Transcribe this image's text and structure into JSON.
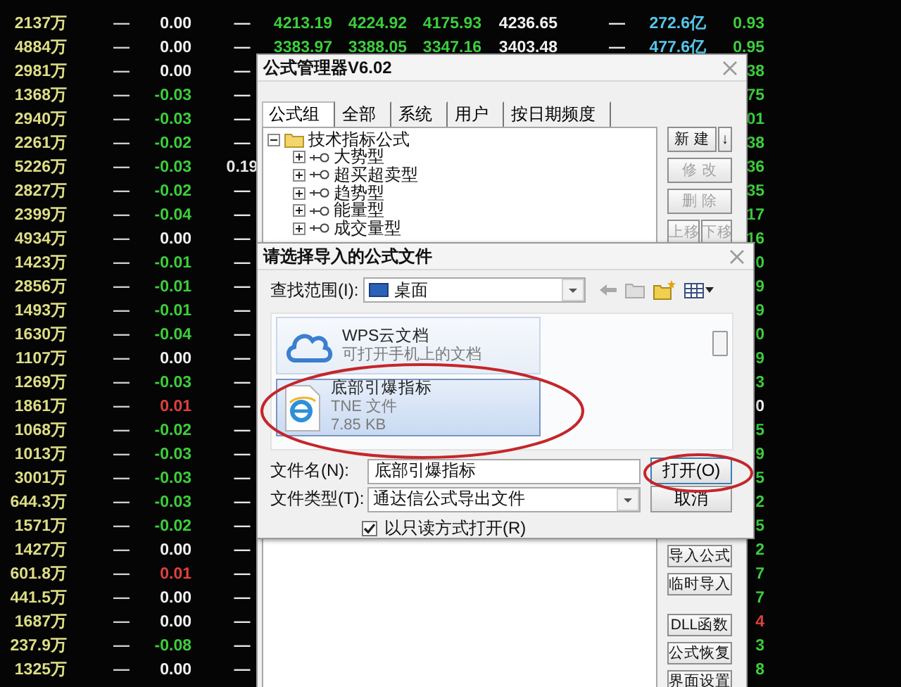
{
  "quote_table": {
    "rows": [
      {
        "amount": "2137万",
        "col_2": "—",
        "change": {
          "text": "0.00",
          "color": "#f2f2f2"
        },
        "col_4": "—",
        "prices": [
          "4213.19",
          "4224.92",
          "4175.93",
          "4236.65"
        ],
        "col_9": "—",
        "volume": "272.6亿",
        "ratio": {
          "text": "0.93",
          "color": "#3ccf3c"
        }
      },
      {
        "amount": "4884万",
        "col_2": "—",
        "change": {
          "text": "0.00",
          "color": "#f2f2f2"
        },
        "col_4": "—",
        "prices": [
          "3383.97",
          "3388.05",
          "3347.16",
          "3403.48"
        ],
        "col_9": "—",
        "volume": "477.6亿",
        "ratio": {
          "text": "0.95",
          "color": "#3ccf3c"
        }
      },
      {
        "amount": "2981万",
        "col_2": "—",
        "change": {
          "text": "0.00",
          "color": "#f2f2f2"
        },
        "col_4": "—",
        "ratio": {
          "text": "38",
          "color": "#3ccf3c"
        }
      },
      {
        "amount": "1368万",
        "col_2": "—",
        "change": {
          "text": "-0.03",
          "color": "#3ccf3c"
        },
        "col_4": "—",
        "ratio": {
          "text": "75",
          "color": "#3ccf3c"
        }
      },
      {
        "amount": "2940万",
        "col_2": "—",
        "change": {
          "text": "-0.03",
          "color": "#3ccf3c"
        },
        "col_4": "—",
        "ratio": {
          "text": "01",
          "color": "#3ccf3c"
        }
      },
      {
        "amount": "2261万",
        "col_2": "—",
        "change": {
          "text": "-0.02",
          "color": "#3ccf3c"
        },
        "col_4": "—",
        "ratio": {
          "text": "38",
          "color": "#3ccf3c"
        }
      },
      {
        "amount": "5226万",
        "col_2": "—",
        "change": {
          "text": "-0.03",
          "color": "#3ccf3c"
        },
        "col_4": "0.19",
        "ratio": {
          "text": "36",
          "color": "#3ccf3c"
        }
      },
      {
        "amount": "2827万",
        "col_2": "—",
        "change": {
          "text": "-0.02",
          "color": "#3ccf3c"
        },
        "col_4": "—",
        "ratio": {
          "text": "35",
          "color": "#3ccf3c"
        }
      },
      {
        "amount": "2399万",
        "col_2": "—",
        "change": {
          "text": "-0.04",
          "color": "#3ccf3c"
        },
        "col_4": "—",
        "ratio": {
          "text": "17",
          "color": "#3ccf3c"
        }
      },
      {
        "amount": "4934万",
        "col_2": "—",
        "change": {
          "text": "0.00",
          "color": "#f2f2f2"
        },
        "col_4": "—",
        "ratio": {
          "text": "16",
          "color": "#3ccf3c"
        }
      },
      {
        "amount": "1423万",
        "col_2": "—",
        "change": {
          "text": "-0.01",
          "color": "#3ccf3c"
        },
        "col_4": "—",
        "ratio": {
          "text": "0",
          "color": "#3ccf3c"
        }
      },
      {
        "amount": "2856万",
        "col_2": "—",
        "change": {
          "text": "-0.01",
          "color": "#3ccf3c"
        },
        "col_4": "—",
        "ratio": {
          "text": "9",
          "color": "#3ccf3c"
        }
      },
      {
        "amount": "1493万",
        "col_2": "—",
        "change": {
          "text": "-0.01",
          "color": "#3ccf3c"
        },
        "col_4": "—",
        "ratio": {
          "text": "9",
          "color": "#3ccf3c"
        }
      },
      {
        "amount": "1630万",
        "col_2": "—",
        "change": {
          "text": "-0.04",
          "color": "#3ccf3c"
        },
        "col_4": "—",
        "ratio": {
          "text": "0",
          "color": "#3ccf3c"
        }
      },
      {
        "amount": "1107万",
        "col_2": "—",
        "change": {
          "text": "0.00",
          "color": "#f2f2f2"
        },
        "col_4": "—",
        "ratio": {
          "text": "9",
          "color": "#3ccf3c"
        }
      },
      {
        "amount": "1269万",
        "col_2": "—",
        "change": {
          "text": "-0.03",
          "color": "#3ccf3c"
        },
        "col_4": "—",
        "ratio": {
          "text": "3",
          "color": "#3ccf3c"
        }
      },
      {
        "amount": "1861万",
        "col_2": "—",
        "change": {
          "text": "0.01",
          "color": "#e04040"
        },
        "col_4": "—",
        "ratio": {
          "text": "0",
          "color": "#f2f2f2"
        }
      },
      {
        "amount": "1068万",
        "col_2": "—",
        "change": {
          "text": "-0.02",
          "color": "#3ccf3c"
        },
        "col_4": "—",
        "ratio": {
          "text": "5",
          "color": "#3ccf3c"
        }
      },
      {
        "amount": "1013万",
        "col_2": "—",
        "change": {
          "text": "-0.03",
          "color": "#3ccf3c"
        },
        "col_4": "—",
        "ratio": {
          "text": "9",
          "color": "#3ccf3c"
        }
      },
      {
        "amount": "3001万",
        "col_2": "—",
        "change": {
          "text": "-0.03",
          "color": "#3ccf3c"
        },
        "col_4": "—",
        "ratio": {
          "text": "5",
          "color": "#3ccf3c"
        }
      },
      {
        "amount": "644.3万",
        "col_2": "—",
        "change": {
          "text": "-0.03",
          "color": "#3ccf3c"
        },
        "col_4": "—",
        "ratio": {
          "text": "2",
          "color": "#3ccf3c"
        }
      },
      {
        "amount": "1571万",
        "col_2": "—",
        "change": {
          "text": "-0.02",
          "color": "#3ccf3c"
        },
        "col_4": "—",
        "ratio": {
          "text": "5",
          "color": "#3ccf3c"
        }
      },
      {
        "amount": "1427万",
        "col_2": "—",
        "change": {
          "text": "0.00",
          "color": "#f2f2f2"
        },
        "col_4": "—",
        "ratio": {
          "text": "2",
          "color": "#3ccf3c"
        }
      },
      {
        "amount": "601.8万",
        "col_2": "—",
        "change": {
          "text": "0.01",
          "color": "#e04040"
        },
        "col_4": "—",
        "ratio": {
          "text": "7",
          "color": "#3ccf3c"
        }
      },
      {
        "amount": "441.5万",
        "col_2": "—",
        "change": {
          "text": "0.00",
          "color": "#f2f2f2"
        },
        "col_4": "—",
        "ratio": {
          "text": "7",
          "color": "#3ccf3c"
        }
      },
      {
        "amount": "1687万",
        "col_2": "—",
        "change": {
          "text": "0.00",
          "color": "#f2f2f2"
        },
        "col_4": "—",
        "ratio": {
          "text": "4",
          "color": "#e04040"
        }
      },
      {
        "amount": "237.9万",
        "col_2": "—",
        "change": {
          "text": "-0.08",
          "color": "#3ccf3c"
        },
        "col_4": "—",
        "ratio": {
          "text": "3",
          "color": "#3ccf3c"
        }
      },
      {
        "amount": "1325万",
        "col_2": "—",
        "change": {
          "text": "0.00",
          "color": "#f2f2f2"
        },
        "col_4": "—",
        "ratio": {
          "text": "8",
          "color": "#3ccf3c"
        }
      }
    ]
  },
  "formula_manager": {
    "title": "公式管理器V6.02",
    "tabs": [
      {
        "label": "公式组",
        "selected": true
      },
      {
        "label": "全部",
        "selected": false
      },
      {
        "label": "系统",
        "selected": false
      },
      {
        "label": "用户",
        "selected": false
      },
      {
        "label": "按日期频度",
        "selected": false
      }
    ],
    "tree": [
      {
        "label": "技术指标公式",
        "expanded": true,
        "children": [
          {
            "label": "大势型",
            "expanded": false
          },
          {
            "label": "超买超卖型",
            "expanded": false
          },
          {
            "label": "趋势型",
            "expanded": false
          },
          {
            "label": "能量型",
            "expanded": false
          },
          {
            "label": "成交量型",
            "expanded": false
          }
        ]
      }
    ],
    "button_rows": [
      [
        {
          "label": "新 建",
          "kind": "text",
          "disabled": false
        },
        {
          "label": "↓",
          "kind": "arrow",
          "disabled": false
        }
      ],
      [
        {
          "label": "修 改",
          "kind": "text",
          "disabled": true
        }
      ],
      [
        {
          "label": "删 除",
          "kind": "text",
          "disabled": true
        }
      ],
      [
        {
          "label": "上移",
          "kind": "text",
          "disabled": true
        },
        {
          "label": "下移",
          "kind": "text",
          "disabled": true
        }
      ]
    ],
    "bottom_button_groups": [
      [
        {
          "label": "导入公式",
          "disabled": false
        },
        {
          "label": "临时导入",
          "disabled": false
        }
      ],
      [
        {
          "label": "DLL函数",
          "disabled": false
        },
        {
          "label": "公式恢复",
          "disabled": false
        },
        {
          "label": "界面设置",
          "disabled": false
        }
      ]
    ]
  },
  "import_dialog": {
    "title": "请选择导入的公式文件",
    "look_in": {
      "label": "查找范围(I):",
      "value": "桌面"
    },
    "files": [
      {
        "kind": "cloud",
        "name": "WPS云文档",
        "lines": [
          "可打开手机上的文档"
        ],
        "selected": false
      },
      {
        "kind": "document",
        "name": "底部引爆指标",
        "lines": [
          "TNE 文件",
          "7.85 KB"
        ],
        "selected": true
      }
    ],
    "file_name": {
      "label": "文件名(N):",
      "value": "底部引爆指标"
    },
    "file_type": {
      "label": "文件类型(T):",
      "value": "通达信公式导出文件"
    },
    "read_only": {
      "label": "以只读方式打开(R)",
      "checked": true
    },
    "buttons": [
      {
        "label": "打开(O)",
        "default": true
      },
      {
        "label": "取消",
        "default": false
      }
    ]
  }
}
